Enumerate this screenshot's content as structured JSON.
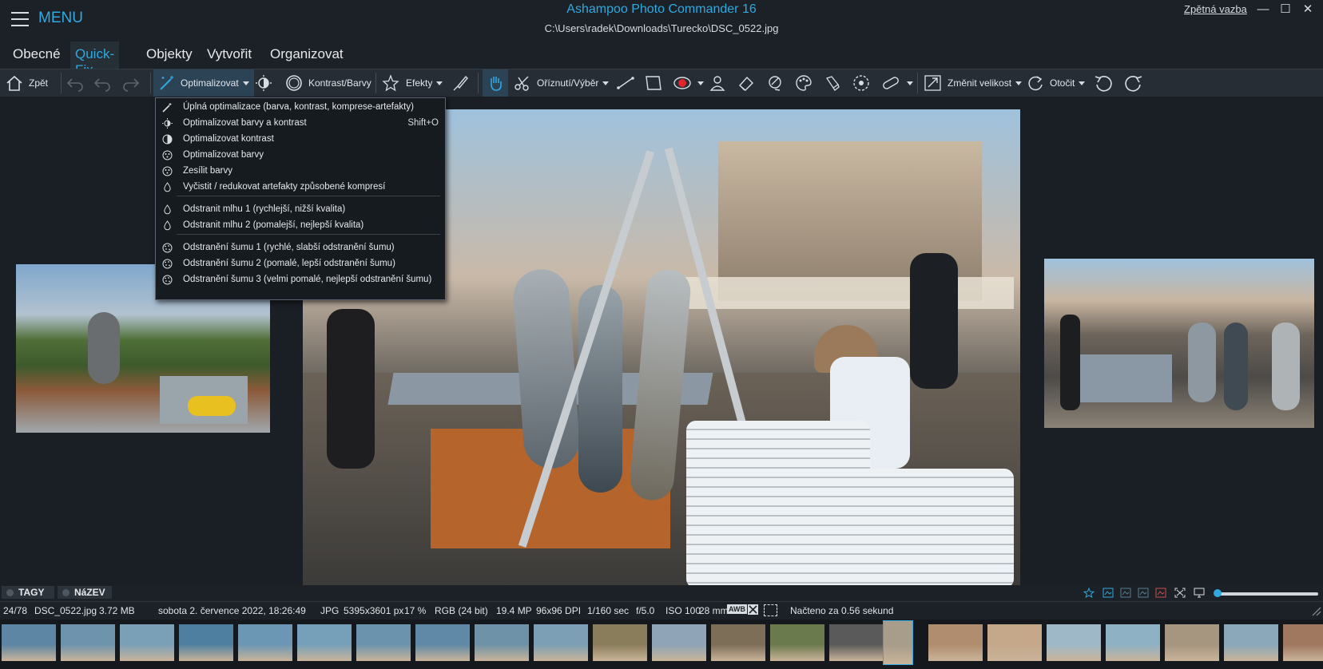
{
  "app": {
    "menu_label": "MENU",
    "title": "Ashampoo Photo Commander 16",
    "path": "C:\\Users\\radek\\Downloads\\Turecko\\DSC_0522.jpg",
    "feedback_link": "Zpětná vazba",
    "window_buttons": [
      "—",
      "☐",
      "✕"
    ]
  },
  "tabs": [
    {
      "label": "Obecné",
      "active": false
    },
    {
      "label": "Quick-Fix",
      "active": true
    },
    {
      "label": "Objekty",
      "active": false
    },
    {
      "label": "Vytvořit",
      "active": false
    },
    {
      "label": "Organizovat",
      "active": false
    }
  ],
  "toolbar": {
    "back": "Zpět",
    "optimize": "Optimalizovat",
    "contrast_colors": "Kontrast/Barvy",
    "effects": "Efekty",
    "crop_select": "Oříznutí/Výběr",
    "resize": "Změnit velikost",
    "rotate": "Otočit"
  },
  "dropdown": {
    "items": [
      {
        "label": "Úplná optimalizace (barva, kontrast, komprese-artefakty)",
        "shortcut": "",
        "icon": "magic-wand-icon"
      },
      {
        "label": "Optimalizovat barvy a kontrast",
        "shortcut": "Shift+O",
        "icon": "sun-contrast-icon"
      },
      {
        "label": "Optimalizovat kontrast",
        "shortcut": "",
        "icon": "half-circle-icon"
      },
      {
        "label": "Optimalizovat barvy",
        "shortcut": "",
        "icon": "color-wheel-icon"
      },
      {
        "label": "Zesílit barvy",
        "shortcut": "",
        "icon": "color-wheel-icon"
      },
      {
        "label": "Vyčistit / redukovat artefakty způsobené kompresí",
        "shortcut": "",
        "icon": "drop-icon"
      },
      {
        "label": "Odstranit mlhu 1 (rychlejší, nižší kvalita)",
        "shortcut": "",
        "icon": "drop-icon"
      },
      {
        "label": "Odstranit mlhu 2 (pomalejší, nejlepší kvalita)",
        "shortcut": "",
        "icon": "drop-icon"
      },
      {
        "label": "Odstranění šumu 1 (rychlé, slabší odstranění šumu)",
        "shortcut": "",
        "icon": "noise-icon"
      },
      {
        "label": "Odstranění šumu 2 (pomalé, lepší odstranění šumu)",
        "shortcut": "",
        "icon": "noise-icon"
      },
      {
        "label": "Odstranění šumu 3 (velmi pomalé, nejlepší odstranění šumu)",
        "shortcut": "",
        "icon": "noise-icon"
      }
    ]
  },
  "tagbar": {
    "tags": "TAGY",
    "name": "NáZEV"
  },
  "status": {
    "index": "24/78",
    "filename": "DSC_0522.jpg",
    "size": "3.72 MB",
    "date": "sobota 2. července 2022, 18:26:49",
    "format": "JPG",
    "dimensions": "5395x3601 px",
    "zoom": "17 %",
    "color": "RGB (24 bit)",
    "megapixels": "19.4 MP",
    "dpi": "96x96 DPI",
    "shutter": "1/160 sec",
    "aperture": "f/5.0",
    "iso": "ISO 100",
    "focal": "28 mm",
    "awb": "AWB",
    "loaded": "Načteno za 0.56 sekund"
  },
  "filmstrip": {
    "count": 23,
    "colors": [
      "#5c86a3",
      "#6d93ad",
      "#7aa0b8",
      "#4f7fa0",
      "#6b96b4",
      "#76a0ba",
      "#6c93ad",
      "#5f89a6",
      "#6e92a8",
      "#7c9fb5",
      "#8a7d5c",
      "#8fa4b6",
      "#7d6e58",
      "#6b7a4d",
      "#5a5a5a",
      "#a89c8a",
      "#b08d6e",
      "#c5a78a",
      "#9fb8c7",
      "#8fb1c4",
      "#a6957f",
      "#8aa8ba",
      "#a07860"
    ]
  },
  "zoom_slider": {
    "value": 0.03
  }
}
